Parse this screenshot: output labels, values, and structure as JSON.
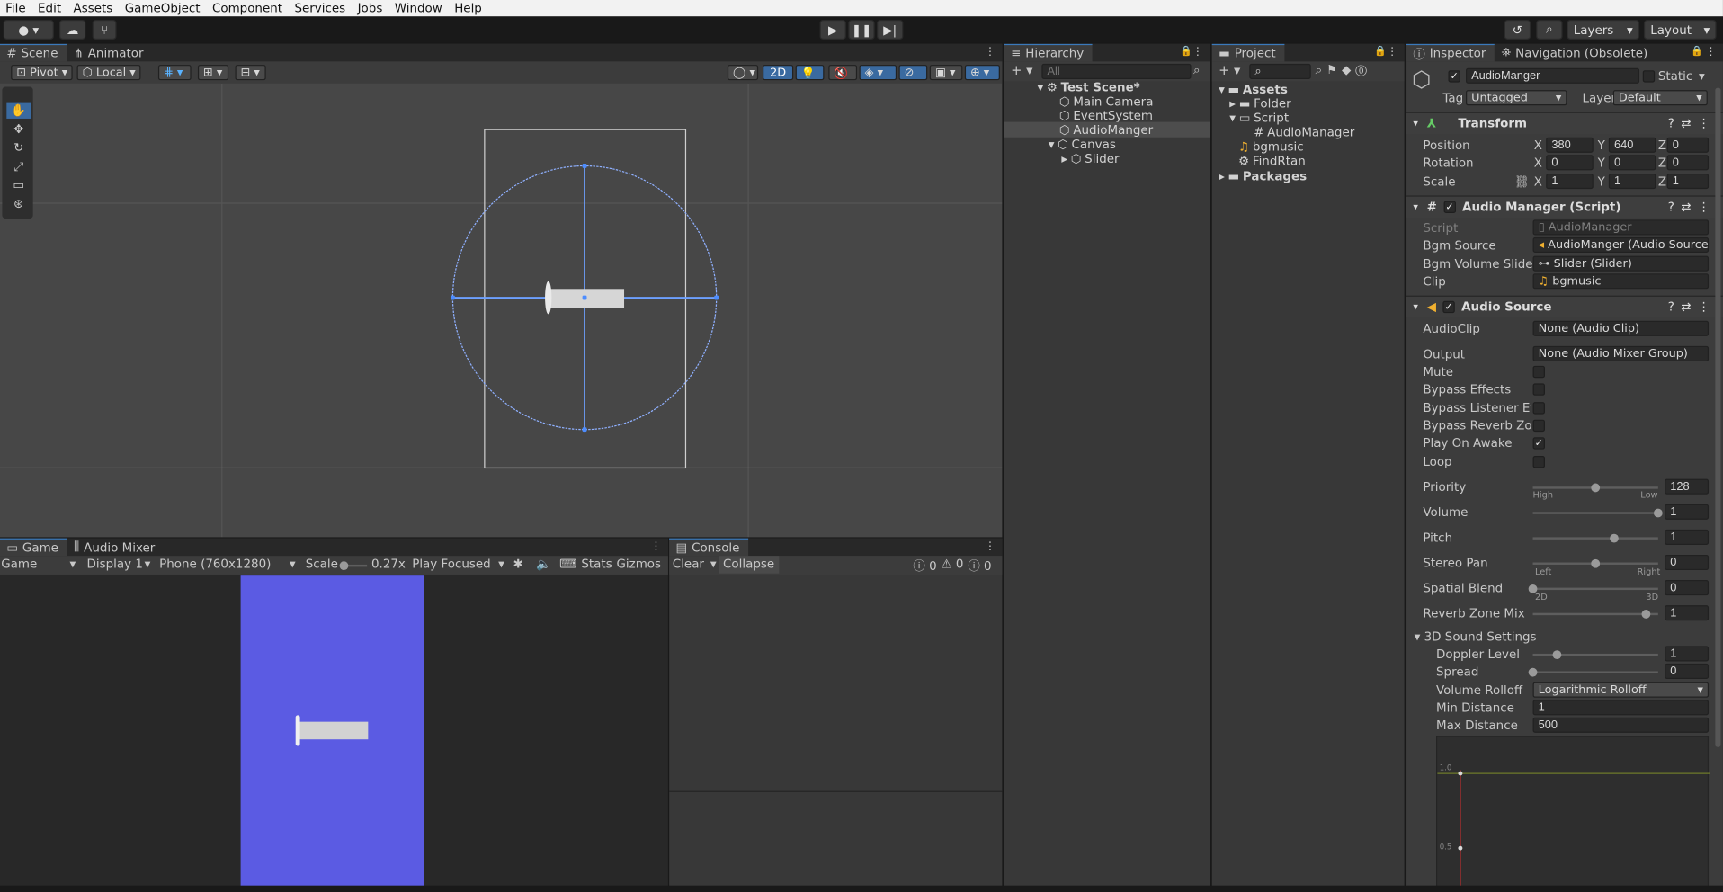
{
  "menu": [
    "File",
    "Edit",
    "Assets",
    "GameObject",
    "Component",
    "Services",
    "Jobs",
    "Window",
    "Help"
  ],
  "toolbar": {
    "layers_label": "Layers",
    "layout_label": "Layout"
  },
  "scene": {
    "tabs": [
      "Scene",
      "Animator"
    ],
    "pivot": "Pivot",
    "local": "Local",
    "mode_2d": "2D"
  },
  "game": {
    "tabs": [
      "Game",
      "Audio Mixer"
    ],
    "display_type": "Game",
    "display": "Display 1",
    "resolution": "Phone (760x1280)",
    "scale_label": "Scale",
    "scale_value": "0.27x",
    "play_mode": "Play Focused",
    "stats": "Stats",
    "gizmos": "Gizmos",
    "canvas_color": "#5b5be3"
  },
  "console": {
    "tab": "Console",
    "clear": "Clear",
    "collapse": "Collapse",
    "count_log": "0",
    "count_warn": "0",
    "count_err": "0"
  },
  "hierarchy": {
    "tab": "Hierarchy",
    "search_placeholder": "All",
    "items": [
      "Test Scene*",
      "Main Camera",
      "EventSystem",
      "AudioManger",
      "Canvas",
      "Slider"
    ]
  },
  "project": {
    "tab": "Project",
    "items": [
      "Assets",
      "Folder",
      "Script",
      "AudioManager",
      "bgmusic",
      "FindRtan",
      "Packages"
    ]
  },
  "inspector": {
    "tabs": [
      "Inspector",
      "Navigation (Obsolete)"
    ],
    "object_name": "AudioManger",
    "static_label": "Static",
    "tag_label": "Tag",
    "tag_value": "Untagged",
    "layer_label": "Layer",
    "layer_value": "Default",
    "transform": {
      "title": "Transform",
      "position_label": "Position",
      "rotation_label": "Rotation",
      "scale_label": "Scale",
      "position": [
        "380",
        "640",
        "0"
      ],
      "rotation": [
        "0",
        "0",
        "0"
      ],
      "scale": [
        "1",
        "1",
        "1"
      ],
      "axes": [
        "X",
        "Y",
        "Z"
      ]
    },
    "audio_manager": {
      "title": "Audio Manager (Script)",
      "script_label": "Script",
      "script_value": "AudioManager",
      "bgm_source_label": "Bgm Source",
      "bgm_source_value": "AudioManger (Audio Source",
      "bgm_slider_label": "Bgm Volume Slider",
      "bgm_slider_value": "Slider (Slider)",
      "clip_label": "Clip",
      "clip_value": "bgmusic"
    },
    "audio_source": {
      "title": "Audio Source",
      "audioclip_label": "AudioClip",
      "audioclip_value": "None (Audio Clip)",
      "output_label": "Output",
      "output_value": "None (Audio Mixer Group)",
      "mute_label": "Mute",
      "bypass_effects_label": "Bypass Effects",
      "bypass_listener_label": "Bypass Listener Effec",
      "bypass_reverb_label": "Bypass Reverb Zones",
      "play_on_awake_label": "Play On Awake",
      "loop_label": "Loop",
      "priority_label": "Priority",
      "priority_value": "128",
      "priority_fraction": 0.5,
      "priority_low": "Low",
      "priority_high": "High",
      "volume_label": "Volume",
      "volume_value": "1",
      "volume_fraction": 1.0,
      "pitch_label": "Pitch",
      "pitch_value": "1",
      "pitch_fraction": 0.65,
      "stereo_label": "Stereo Pan",
      "stereo_value": "0",
      "stereo_fraction": 0.5,
      "stereo_left": "Left",
      "stereo_right": "Right",
      "spatial_label": "Spatial Blend",
      "spatial_value": "0",
      "spatial_fraction": 0.0,
      "spatial_2d": "2D",
      "spatial_3d": "3D",
      "reverb_label": "Reverb Zone Mix",
      "reverb_value": "1",
      "reverb_fraction": 0.9,
      "sound3d_label": "3D Sound Settings",
      "doppler_label": "Doppler Level",
      "doppler_value": "1",
      "doppler_fraction": 0.19,
      "spread_label": "Spread",
      "spread_value": "0",
      "spread_fraction": 0.0,
      "rolloff_label": "Volume Rolloff",
      "rolloff_value": "Logarithmic Rolloff",
      "min_dist_label": "Min Distance",
      "min_dist_value": "1",
      "max_dist_label": "Max Distance",
      "max_dist_value": "500",
      "graph_tick_1": "1.0",
      "graph_tick_05": "0.5"
    }
  }
}
